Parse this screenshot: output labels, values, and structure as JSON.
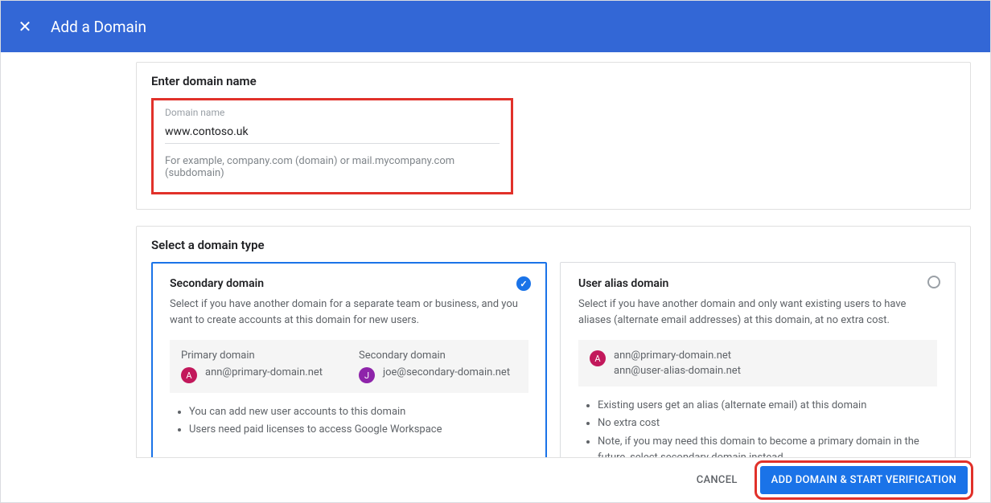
{
  "header": {
    "title": "Add a Domain"
  },
  "enter_section": {
    "title": "Enter domain name",
    "field_label": "Domain name",
    "value": "www.contoso.uk",
    "hint": "For example, company.com (domain) or mail.mycompany.com (subdomain)"
  },
  "select_section": {
    "title": "Select a domain type",
    "secondary": {
      "title": "Secondary domain",
      "desc": "Select if you have another domain for a separate team or business, and you want to create accounts at this domain for new users.",
      "primary_label": "Primary domain",
      "primary_avatar": "A",
      "primary_email": "ann@primary-domain.net",
      "secondary_label": "Secondary domain",
      "secondary_avatar": "J",
      "secondary_email": "joe@secondary-domain.net",
      "bullets": [
        "You can add new user accounts to this domain",
        "Users need paid licenses to access Google Workspace"
      ]
    },
    "alias": {
      "title": "User alias domain",
      "desc": "Select if you have another domain and only want existing users to have aliases (alternate email addresses) at this domain, at no extra cost.",
      "avatar": "A",
      "emails": [
        "ann@primary-domain.net",
        "ann@user-alias-domain.net"
      ],
      "bullets": [
        "Existing users get an alias (alternate email) at this domain",
        "No extra cost",
        "Note, if you may need this domain to become a primary domain in the future, select secondary domain instead."
      ]
    }
  },
  "footer": {
    "cancel": "CANCEL",
    "submit": "ADD DOMAIN & START VERIFICATION"
  }
}
